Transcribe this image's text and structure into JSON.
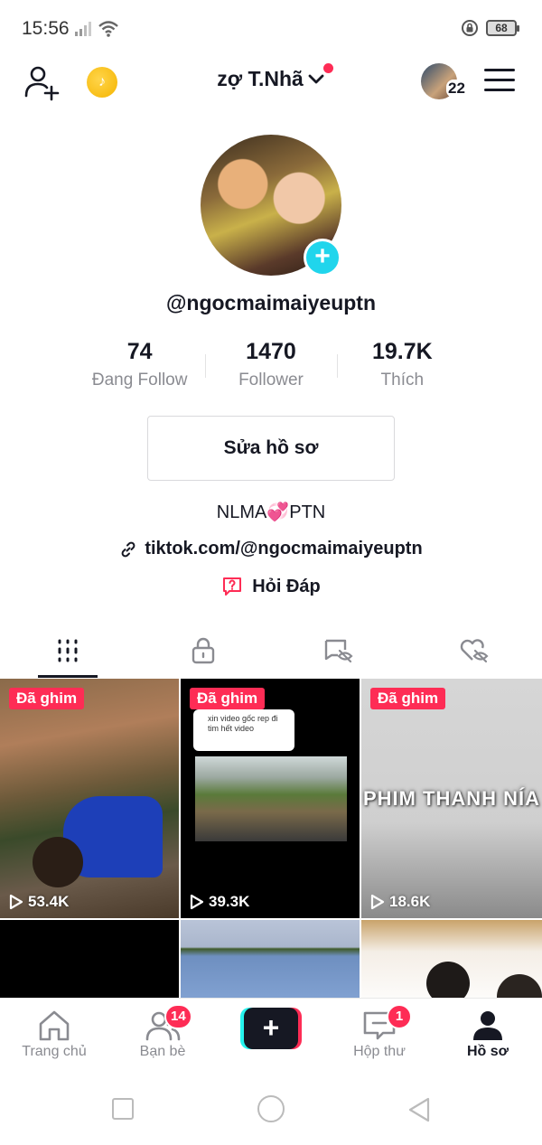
{
  "status_bar": {
    "time": "15:56",
    "battery": "68"
  },
  "header": {
    "account_name": "zợ T.Nhã",
    "following_badge_count": "22"
  },
  "profile": {
    "username": "@ngocmaimaiyeuptn",
    "stats": [
      {
        "value": "74",
        "label": "Đang Follow"
      },
      {
        "value": "1470",
        "label": "Follower"
      },
      {
        "value": "19.7K",
        "label": "Thích"
      }
    ],
    "edit_button": "Sửa hồ sơ",
    "bio": "NLMA💞PTN",
    "link": "tiktok.com/@ngocmaimaiyeuptn",
    "qa": "Hỏi Đáp"
  },
  "tabs": [
    {
      "icon": "grid-icon",
      "active": true
    },
    {
      "icon": "lock-icon",
      "active": false
    },
    {
      "icon": "hidden-repost-icon",
      "active": false
    },
    {
      "icon": "hidden-like-icon",
      "active": false
    }
  ],
  "videos": [
    {
      "pinned": "Đã ghim",
      "views": "53.4K"
    },
    {
      "pinned": "Đã ghim",
      "views": "39.3K",
      "comment": "xin video gốc rep đi tim hết video"
    },
    {
      "pinned": "Đã ghim",
      "views": "18.6K",
      "overlay_text": "PHIM THANH NÍA"
    }
  ],
  "bottom_nav": [
    {
      "label": "Trang chủ",
      "icon": "home-icon"
    },
    {
      "label": "Bạn bè",
      "icon": "friends-icon",
      "badge": "14"
    },
    {
      "label": "",
      "icon": "plus-icon"
    },
    {
      "label": "Hộp thư",
      "icon": "inbox-icon",
      "badge": "1"
    },
    {
      "label": "Hồ sơ",
      "icon": "profile-icon",
      "active": true
    }
  ],
  "colors": {
    "accent": "#fe2c55",
    "cyan": "#20d5ec",
    "text": "#161823",
    "muted": "#8a8b91"
  }
}
